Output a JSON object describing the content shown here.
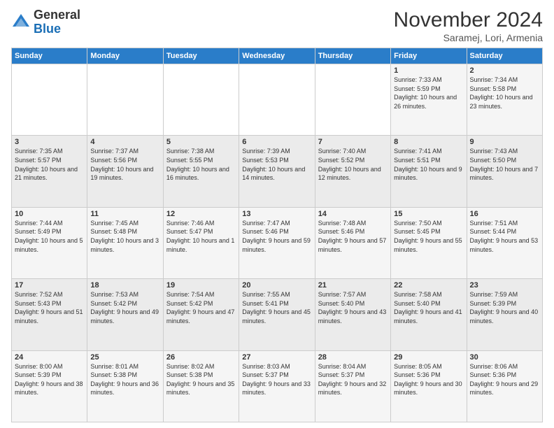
{
  "header": {
    "logo_general": "General",
    "logo_blue": "Blue",
    "month_title": "November 2024",
    "location": "Saramej, Lori, Armenia"
  },
  "weekdays": [
    "Sunday",
    "Monday",
    "Tuesday",
    "Wednesday",
    "Thursday",
    "Friday",
    "Saturday"
  ],
  "weeks": [
    [
      {
        "day": "",
        "sunrise": "",
        "sunset": "",
        "daylight": ""
      },
      {
        "day": "",
        "sunrise": "",
        "sunset": "",
        "daylight": ""
      },
      {
        "day": "",
        "sunrise": "",
        "sunset": "",
        "daylight": ""
      },
      {
        "day": "",
        "sunrise": "",
        "sunset": "",
        "daylight": ""
      },
      {
        "day": "",
        "sunrise": "",
        "sunset": "",
        "daylight": ""
      },
      {
        "day": "1",
        "sunrise": "Sunrise: 7:33 AM",
        "sunset": "Sunset: 5:59 PM",
        "daylight": "Daylight: 10 hours and 26 minutes."
      },
      {
        "day": "2",
        "sunrise": "Sunrise: 7:34 AM",
        "sunset": "Sunset: 5:58 PM",
        "daylight": "Daylight: 10 hours and 23 minutes."
      }
    ],
    [
      {
        "day": "3",
        "sunrise": "Sunrise: 7:35 AM",
        "sunset": "Sunset: 5:57 PM",
        "daylight": "Daylight: 10 hours and 21 minutes."
      },
      {
        "day": "4",
        "sunrise": "Sunrise: 7:37 AM",
        "sunset": "Sunset: 5:56 PM",
        "daylight": "Daylight: 10 hours and 19 minutes."
      },
      {
        "day": "5",
        "sunrise": "Sunrise: 7:38 AM",
        "sunset": "Sunset: 5:55 PM",
        "daylight": "Daylight: 10 hours and 16 minutes."
      },
      {
        "day": "6",
        "sunrise": "Sunrise: 7:39 AM",
        "sunset": "Sunset: 5:53 PM",
        "daylight": "Daylight: 10 hours and 14 minutes."
      },
      {
        "day": "7",
        "sunrise": "Sunrise: 7:40 AM",
        "sunset": "Sunset: 5:52 PM",
        "daylight": "Daylight: 10 hours and 12 minutes."
      },
      {
        "day": "8",
        "sunrise": "Sunrise: 7:41 AM",
        "sunset": "Sunset: 5:51 PM",
        "daylight": "Daylight: 10 hours and 9 minutes."
      },
      {
        "day": "9",
        "sunrise": "Sunrise: 7:43 AM",
        "sunset": "Sunset: 5:50 PM",
        "daylight": "Daylight: 10 hours and 7 minutes."
      }
    ],
    [
      {
        "day": "10",
        "sunrise": "Sunrise: 7:44 AM",
        "sunset": "Sunset: 5:49 PM",
        "daylight": "Daylight: 10 hours and 5 minutes."
      },
      {
        "day": "11",
        "sunrise": "Sunrise: 7:45 AM",
        "sunset": "Sunset: 5:48 PM",
        "daylight": "Daylight: 10 hours and 3 minutes."
      },
      {
        "day": "12",
        "sunrise": "Sunrise: 7:46 AM",
        "sunset": "Sunset: 5:47 PM",
        "daylight": "Daylight: 10 hours and 1 minute."
      },
      {
        "day": "13",
        "sunrise": "Sunrise: 7:47 AM",
        "sunset": "Sunset: 5:46 PM",
        "daylight": "Daylight: 9 hours and 59 minutes."
      },
      {
        "day": "14",
        "sunrise": "Sunrise: 7:48 AM",
        "sunset": "Sunset: 5:46 PM",
        "daylight": "Daylight: 9 hours and 57 minutes."
      },
      {
        "day": "15",
        "sunrise": "Sunrise: 7:50 AM",
        "sunset": "Sunset: 5:45 PM",
        "daylight": "Daylight: 9 hours and 55 minutes."
      },
      {
        "day": "16",
        "sunrise": "Sunrise: 7:51 AM",
        "sunset": "Sunset: 5:44 PM",
        "daylight": "Daylight: 9 hours and 53 minutes."
      }
    ],
    [
      {
        "day": "17",
        "sunrise": "Sunrise: 7:52 AM",
        "sunset": "Sunset: 5:43 PM",
        "daylight": "Daylight: 9 hours and 51 minutes."
      },
      {
        "day": "18",
        "sunrise": "Sunrise: 7:53 AM",
        "sunset": "Sunset: 5:42 PM",
        "daylight": "Daylight: 9 hours and 49 minutes."
      },
      {
        "day": "19",
        "sunrise": "Sunrise: 7:54 AM",
        "sunset": "Sunset: 5:42 PM",
        "daylight": "Daylight: 9 hours and 47 minutes."
      },
      {
        "day": "20",
        "sunrise": "Sunrise: 7:55 AM",
        "sunset": "Sunset: 5:41 PM",
        "daylight": "Daylight: 9 hours and 45 minutes."
      },
      {
        "day": "21",
        "sunrise": "Sunrise: 7:57 AM",
        "sunset": "Sunset: 5:40 PM",
        "daylight": "Daylight: 9 hours and 43 minutes."
      },
      {
        "day": "22",
        "sunrise": "Sunrise: 7:58 AM",
        "sunset": "Sunset: 5:40 PM",
        "daylight": "Daylight: 9 hours and 41 minutes."
      },
      {
        "day": "23",
        "sunrise": "Sunrise: 7:59 AM",
        "sunset": "Sunset: 5:39 PM",
        "daylight": "Daylight: 9 hours and 40 minutes."
      }
    ],
    [
      {
        "day": "24",
        "sunrise": "Sunrise: 8:00 AM",
        "sunset": "Sunset: 5:39 PM",
        "daylight": "Daylight: 9 hours and 38 minutes."
      },
      {
        "day": "25",
        "sunrise": "Sunrise: 8:01 AM",
        "sunset": "Sunset: 5:38 PM",
        "daylight": "Daylight: 9 hours and 36 minutes."
      },
      {
        "day": "26",
        "sunrise": "Sunrise: 8:02 AM",
        "sunset": "Sunset: 5:38 PM",
        "daylight": "Daylight: 9 hours and 35 minutes."
      },
      {
        "day": "27",
        "sunrise": "Sunrise: 8:03 AM",
        "sunset": "Sunset: 5:37 PM",
        "daylight": "Daylight: 9 hours and 33 minutes."
      },
      {
        "day": "28",
        "sunrise": "Sunrise: 8:04 AM",
        "sunset": "Sunset: 5:37 PM",
        "daylight": "Daylight: 9 hours and 32 minutes."
      },
      {
        "day": "29",
        "sunrise": "Sunrise: 8:05 AM",
        "sunset": "Sunset: 5:36 PM",
        "daylight": "Daylight: 9 hours and 30 minutes."
      },
      {
        "day": "30",
        "sunrise": "Sunrise: 8:06 AM",
        "sunset": "Sunset: 5:36 PM",
        "daylight": "Daylight: 9 hours and 29 minutes."
      }
    ]
  ]
}
